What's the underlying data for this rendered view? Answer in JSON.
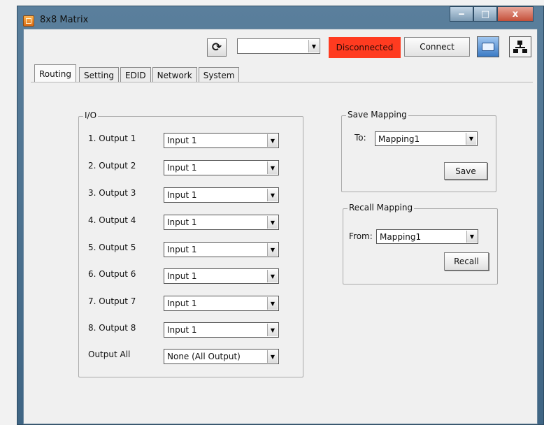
{
  "window": {
    "title": "8x8 Matrix",
    "controls": {
      "minimize": "‒",
      "maximize": "□",
      "close": "x"
    }
  },
  "toolbar": {
    "refresh_icon": "refresh-icon",
    "refresh_glyph": "⟳",
    "port_value": "",
    "status_text": "Disconnected",
    "status_color": "#ff3b20",
    "connect_label": "Connect",
    "serial_icon": "serial-port-icon",
    "network_icon": "network-icon"
  },
  "tabs": [
    {
      "label": "Routing",
      "active": true
    },
    {
      "label": "Setting",
      "active": false
    },
    {
      "label": "EDID",
      "active": false
    },
    {
      "label": "Network",
      "active": false
    },
    {
      "label": "System",
      "active": false
    }
  ],
  "io": {
    "legend": "I/O",
    "rows": [
      {
        "label": "1.  Output 1",
        "value": "Input 1"
      },
      {
        "label": "2.  Output 2",
        "value": "Input 1"
      },
      {
        "label": "3.  Output 3",
        "value": "Input 1"
      },
      {
        "label": "4.  Output 4",
        "value": "Input 1"
      },
      {
        "label": "5.  Output 5",
        "value": "Input 1"
      },
      {
        "label": "6.  Output 6",
        "value": "Input 1"
      },
      {
        "label": "7.  Output 7",
        "value": "Input 1"
      },
      {
        "label": "8.  Output 8",
        "value": "Input 1"
      }
    ],
    "all_label": "Output All",
    "all_value": "None (All Output)"
  },
  "save_mapping": {
    "legend": "Save Mapping",
    "to_label": "To:",
    "value": "Mapping1",
    "button": "Save"
  },
  "recall_mapping": {
    "legend": "Recall Mapping",
    "from_label": "From:",
    "value": "Mapping1",
    "button": "Recall"
  }
}
